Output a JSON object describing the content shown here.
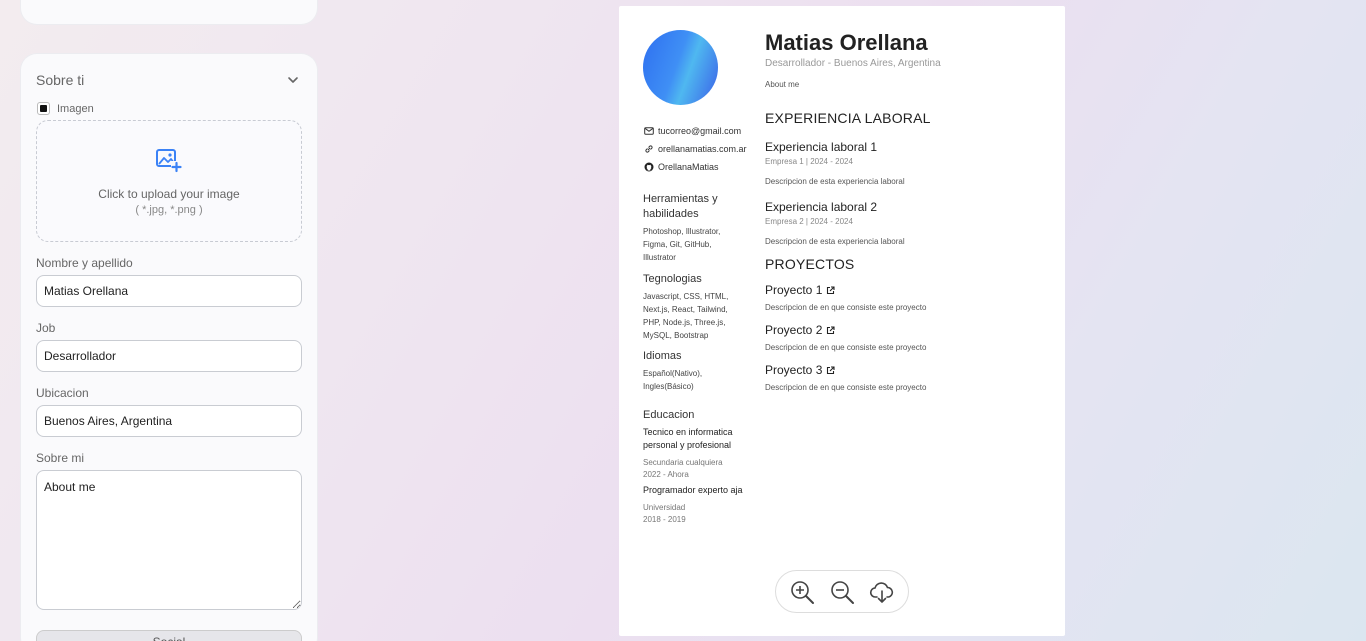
{
  "top_card": {},
  "about_section": {
    "title": "Sobre ti",
    "image_checkbox_label": "Imagen",
    "image_checked": true,
    "upload_text": "Click to upload your image",
    "upload_ext": "( *.jpg, *.png )",
    "name_label": "Nombre y apellido",
    "name_value": "Matias Orellana",
    "job_label": "Job",
    "job_value": "Desarrollador",
    "location_label": "Ubicacion",
    "location_value": "Buenos Aires, Argentina",
    "about_label": "Sobre mi",
    "about_value": "About me",
    "social_button": "Social"
  },
  "cv": {
    "name": "Matias Orellana",
    "role": "Desarrollador - Buenos Aires, Argentina",
    "about": "About me",
    "email": "tucorreo@gmail.com",
    "website": "orellanamatias.com.ar",
    "github": "OrellanaMatias",
    "skills_title": "Herramientas y habilidades",
    "skills": "Photoshop, Illustrator, Figma, Git, GitHub, Illustrator",
    "tech_title": "Tegnologias",
    "tech": "Javascript, CSS, HTML, Next.js, React, Tailwind, PHP, Node.js, Three.js, MySQL, Bootstrap",
    "lang_title": "Idiomas",
    "lang": "Español(Nativo), Ingles(Básico)",
    "edu_title": "Educacion",
    "edu": [
      {
        "title": "Tecnico en informatica personal y profesional",
        "school": "Secundaria cualquiera",
        "years": "2022 - Ahora"
      },
      {
        "title": "Programador experto aja",
        "school": "Universidad",
        "years": "2018 - 2019"
      }
    ],
    "experience_title": "EXPERIENCIA LABORAL",
    "jobs": [
      {
        "title": "Experiencia laboral 1",
        "sub": "Empresa 1 | 2024 - 2024",
        "desc": "Descripcion de esta experiencia laboral"
      },
      {
        "title": "Experiencia laboral 2",
        "sub": "Empresa 2 | 2024 - 2024",
        "desc": "Descripcion de esta experiencia laboral"
      }
    ],
    "projects_title": "PROYECTOS",
    "projects": [
      {
        "title": "Proyecto 1",
        "desc": "Descripcion de en que consiste este proyecto"
      },
      {
        "title": "Proyecto 2",
        "desc": "Descripcion de en que consiste este proyecto"
      },
      {
        "title": "Proyecto 3",
        "desc": "Descripcion de en que consiste este proyecto"
      }
    ]
  },
  "icons": {
    "upload": "image-plus-icon",
    "email": "mail-icon",
    "link": "link-icon",
    "github": "github-icon",
    "external": "external-link-icon",
    "zoom_in": "zoom-in-icon",
    "zoom_out": "zoom-out-icon",
    "download": "cloud-download-icon"
  },
  "colors": {
    "accent": "#3b82f6"
  }
}
